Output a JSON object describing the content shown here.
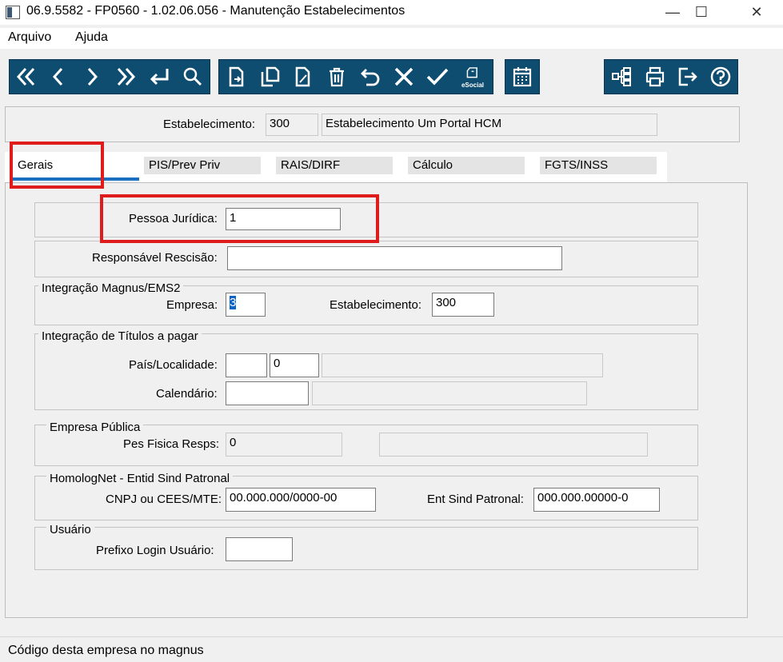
{
  "window": {
    "title": "06.9.5582 - FP0560 - 1.02.06.056 - Manutenção Estabelecimentos",
    "minimize": "—",
    "maximize": "☐",
    "close": "✕"
  },
  "menu": {
    "items": [
      "Arquivo",
      "Ajuda"
    ]
  },
  "toolbar": {
    "esocial_label": "eSocial"
  },
  "header": {
    "estab_label": "Estabelecimento:",
    "estab_code": "300",
    "estab_name": "Estabelecimento Um Portal HCM"
  },
  "tabs": [
    "Gerais",
    "PIS/Prev Priv",
    "RAIS/DIRF",
    "Cálculo",
    "FGTS/INSS"
  ],
  "form": {
    "pessoa_juridica_label": "Pessoa Jurídica:",
    "pessoa_juridica_value": "1",
    "responsavel_label": "Responsável Rescisão:",
    "responsavel_value": "",
    "integ_magnus_title": "Integração Magnus/EMS2",
    "empresa_label": "Empresa:",
    "empresa_value": "3",
    "estab_label": "Estabelecimento:",
    "estab_value": "300",
    "integ_titulos_title": "Integração de Títulos a pagar",
    "pais_label": "País/Localidade:",
    "pais_value": "",
    "localidade_value": "0",
    "pais_desc": "",
    "calendario_label": "Calendário:",
    "calendario_value": "",
    "calendario_desc": "",
    "empresa_publica_title": "Empresa Pública",
    "pes_fisica_label": "Pes Fisica Resps:",
    "pes_fisica_value": "0",
    "pes_fisica_desc": "",
    "homolognet_title": "HomologNet - Entid Sind Patronal",
    "cnpj_label": "CNPJ ou CEES/MTE:",
    "cnpj_value": "00.000.000/0000-00",
    "ent_sind_label": "Ent Sind Patronal:",
    "ent_sind_value": "000.000.00000-0",
    "usuario_title": "Usuário",
    "prefixo_label": "Prefixo Login Usuário:",
    "prefixo_value": ""
  },
  "status": {
    "text": "Código desta empresa no magnus"
  },
  "colors": {
    "toolbar": "#0f4d70",
    "highlight": "#e01b1b",
    "tab_accent": "#1a6fbf"
  }
}
